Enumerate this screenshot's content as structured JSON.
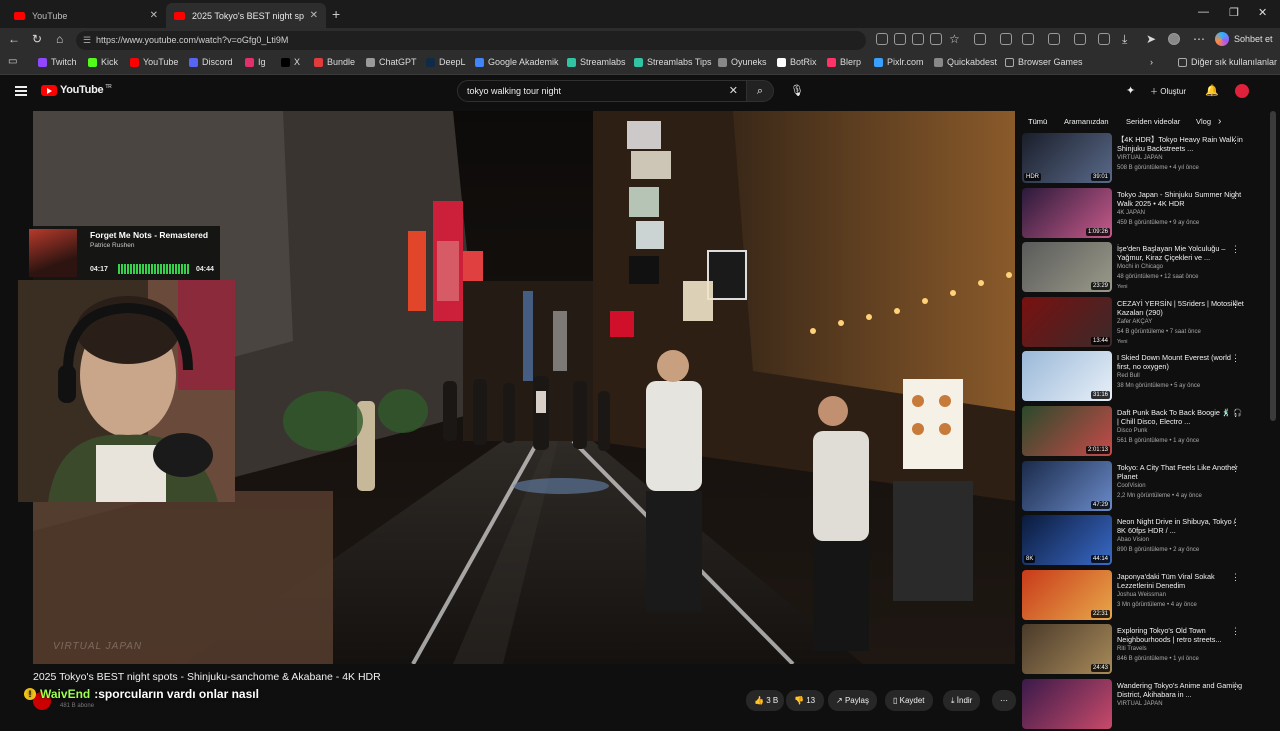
{
  "browser": {
    "tabs": [
      {
        "label": "YouTube",
        "active": false
      },
      {
        "label": "2025 Tokyo's BEST night spots - Sh",
        "active": true
      }
    ],
    "url": "https://www.youtube.com/watch?v=oGfg0_Lti9M",
    "copilot_label": "Sohbet et",
    "bookmarks": [
      {
        "label": "Twitch",
        "color": "#9146ff"
      },
      {
        "label": "Kick",
        "color": "#53fc18"
      },
      {
        "label": "YouTube",
        "color": "#ff0000"
      },
      {
        "label": "Discord",
        "color": "#5865f2"
      },
      {
        "label": "Ig",
        "color": "#e1306c"
      },
      {
        "label": "X",
        "color": "#000000"
      },
      {
        "label": "Bundle",
        "color": "#e23b3b"
      },
      {
        "label": "ChatGPT",
        "color": "#9a9a9a"
      },
      {
        "label": "DeepL",
        "color": "#0f2b46"
      },
      {
        "label": "Google Akademik",
        "color": "#4285f4"
      },
      {
        "label": "Streamlabs",
        "color": "#31c3a2"
      },
      {
        "label": "Streamlabs Tips",
        "color": "#31c3a2"
      },
      {
        "label": "Oyuneks",
        "color": "#888888"
      },
      {
        "label": "BotRix",
        "color": "#ffffff"
      },
      {
        "label": "Blerp",
        "color": "#ff3366"
      },
      {
        "label": "Pixlr.com",
        "color": "#3aa0ff"
      },
      {
        "label": "Quickabdest",
        "color": "#888888"
      },
      {
        "label": "Browser Games",
        "color": "#888888"
      }
    ],
    "other_bookmarks": "Diğer sık kullanılanlar"
  },
  "youtube": {
    "region": "TR",
    "logo_text": "YouTube",
    "search_query": "tokyo walking tour night",
    "create_label": "Oluştur"
  },
  "overlay": {
    "song": "Forget Me Nots - Remastered",
    "artist": "Patrice Rushen",
    "elapsed": "04:17",
    "total": "04:44",
    "chat_user": "WaivEnd",
    "chat_message": "sporcuların vardı onlar nasıl",
    "video_watermark": "VIRTUAL JAPAN"
  },
  "video": {
    "title": "2025 Tokyo's BEST night spots - Shinjuku-sanchome & Akabane - 4K HDR",
    "subscribers": "481 B abone",
    "likes": "3 B",
    "dislikes": "13",
    "share_label": "Paylaş",
    "save_label": "Kaydet",
    "download_label": "İndir"
  },
  "chips": [
    "Tümü",
    "Aramanızdan",
    "Seriden videolar",
    "Vlog"
  ],
  "recommendations": [
    {
      "title": "【4K HDR】Tokyo Heavy Rain Walk in Shinjuku Backstreets ...",
      "channel": "VIRTUAL JAPAN",
      "meta": "508 B görüntüleme • 4 yıl önce",
      "duration": "39:01",
      "badge": "HDR",
      "color_a": "#1a1e2a",
      "color_b": "#5a6a8a"
    },
    {
      "title": "Tokyo Japan - Shinjuku Summer Night Walk 2025 • 4K HDR",
      "channel": "4K JAPAN",
      "meta": "459 B görüntüleme • 9 ay önce",
      "duration": "1:09:26",
      "badge": "",
      "color_a": "#2a1a3a",
      "color_b": "#c85a8a"
    },
    {
      "title": "İşe'den Başlayan Mie Yolculuğu – Yağmur, Kiraz Çiçekleri ve ...",
      "channel": "Mochi in Chicago",
      "meta": "48 görüntüleme • 12 saat önce",
      "duration": "23:29",
      "badge": "",
      "new": "Yeni",
      "color_a": "#5a5a5a",
      "color_b": "#9a9a8a"
    },
    {
      "title": "CEZAYİ YERSİN | 5Sriders | Motosiklet Kazaları (290)",
      "channel": "Zafer AKÇAY",
      "meta": "54 B görüntüleme • 7 saat önce",
      "duration": "13:44",
      "badge": "",
      "new": "Yeni",
      "color_a": "#7a1010",
      "color_b": "#3a2a2a"
    },
    {
      "title": "I Skied Down Mount Everest (world first, no oxygen)",
      "channel": "Red Bull",
      "meta": "38 Mn görüntüleme • 5 ay önce",
      "duration": "31:16",
      "badge": "",
      "color_a": "#9ab8d8",
      "color_b": "#e8f0f8"
    },
    {
      "title": "Daft Punk Back To Back Boogie 🕺 🎧 | Chill Disco, Electro ...",
      "channel": "Disco Punk",
      "meta": "561 B görüntüleme • 1 ay önce",
      "duration": "2:01:13",
      "badge": "",
      "color_a": "#2a4a2a",
      "color_b": "#c84a4a"
    },
    {
      "title": "Tokyo: A City That Feels Like Another Planet",
      "channel": "CoolVision",
      "meta": "2,2 Mn görüntüleme • 4 ay önce",
      "duration": "47:29",
      "badge": "",
      "color_a": "#1a2a4a",
      "color_b": "#6a8ac8"
    },
    {
      "title": "Neon Night Drive in Shibuya, Tokyo / 8K 60fps HDR / ...",
      "channel": "Abao Vision",
      "meta": "890 B görüntüleme • 2 ay önce",
      "duration": "44:14",
      "badge": "8K",
      "color_a": "#0a1a3a",
      "color_b": "#3a6ac8"
    },
    {
      "title": "Japonya'daki Tüm Viral Sokak Lezzetlerini Denedim",
      "channel": "Joshua Weissman",
      "meta": "3 Mn görüntüleme • 4 ay önce",
      "duration": "22:31",
      "badge": "",
      "color_a": "#c83a1a",
      "color_b": "#e8a84a"
    },
    {
      "title": "Exploring Tokyo's Old Town Neighbourhoods | retro streets...",
      "channel": "Riti Travels",
      "meta": "846 B görüntüleme • 1 yıl önce",
      "duration": "24:43",
      "badge": "",
      "color_a": "#4a3a2a",
      "color_b": "#a88a5a"
    },
    {
      "title": "Wandering Tokyo's Anime and Gaming District, Akihabara in ...",
      "channel": "VIRTUAL JAPAN",
      "meta": "",
      "duration": "",
      "badge": "",
      "color_a": "#3a1a4a",
      "color_b": "#c84a6a"
    }
  ]
}
